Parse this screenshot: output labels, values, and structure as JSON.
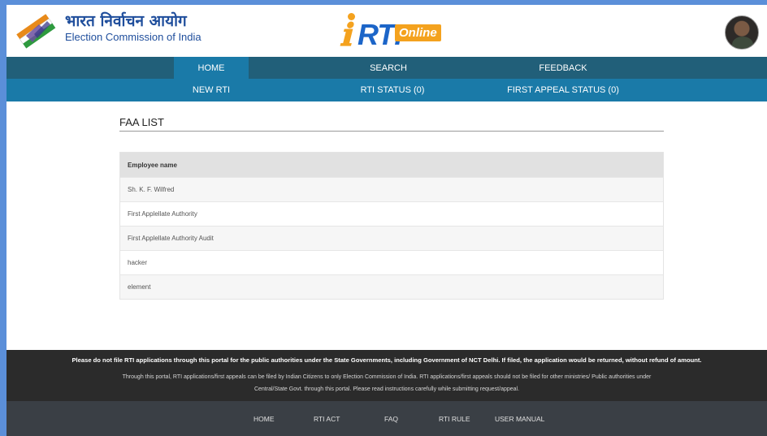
{
  "header": {
    "brand_hindi": "भारत निर्वाचन आयोग",
    "brand_english": "Election Commission of India",
    "rti_logo_text": "RTI",
    "rti_logo_badge": "Online",
    "emblem_icon": "eci-voting-hand-emblem",
    "avatar_icon": "user-avatar"
  },
  "nav_primary": [
    {
      "label": "HOME",
      "active": true
    },
    {
      "label": "SEARCH",
      "active": false
    },
    {
      "label": "FEEDBACK",
      "active": false
    }
  ],
  "nav_secondary": [
    {
      "label": "NEW RTI"
    },
    {
      "label": "RTI STATUS (0)"
    },
    {
      "label": "FIRST APPEAL STATUS (0)"
    }
  ],
  "content": {
    "title": "FAA LIST",
    "table_header": "Employee name",
    "rows": [
      "Sh. K. F. Wilfred",
      "First Applellate Authority",
      "First Applellate Authority Audit",
      "hacker",
      "element"
    ]
  },
  "footer": {
    "notice_bold": "Please do not file RTI applications through this portal for the public authorities under the State Governments, including Government of NCT Delhi. If filed, the application would be returned, without refund of amount.",
    "notice_line1": "Through this portal, RTI applications/first appeals can be filed by Indian Citizens to only Election Commission of India. RTI applications/first appeals should not be filed for other ministries/ Public authorities under",
    "notice_line2": "Central/State Govt. through this portal. Please read instructions carefully while submitting request/appeal.",
    "links": [
      "HOME",
      "RTI ACT",
      "FAQ",
      "RTI RULE",
      "USER MANUAL"
    ]
  },
  "colors": {
    "nav_primary_bg": "#215f79",
    "nav_secondary_bg": "#1a7aa8",
    "brand_blue": "#1f4e9c",
    "rti_orange": "#f4a21e",
    "footer_notice_bg": "#2b2b2b",
    "footer_links_bg": "#3a3f45"
  }
}
